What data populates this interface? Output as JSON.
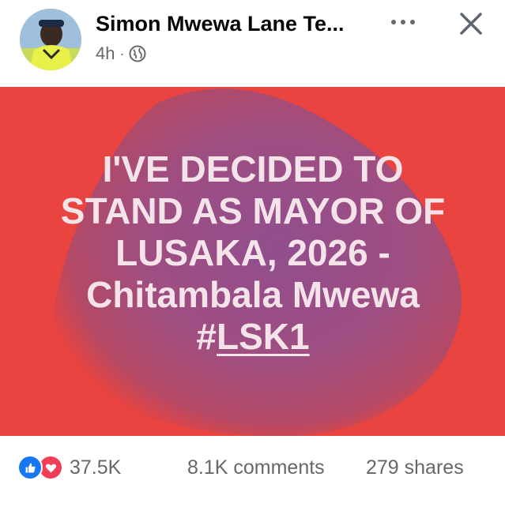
{
  "post": {
    "author": "Simon Mwewa Lane Te...",
    "time": "4h",
    "separator": "·",
    "privacy_icon": "globe-icon",
    "more_icon": "more-options-icon",
    "close_icon": "close-icon"
  },
  "image": {
    "lines": [
      "I'VE DECIDED TO",
      "STAND AS MAYOR OF",
      "LUSAKA, 2026 -",
      "Chitambala Mwewa"
    ],
    "hash": "#",
    "tag": "LSK1",
    "colors": {
      "background": "#e94440",
      "blob": "#9a4f8c",
      "text": "#f4e4ea"
    }
  },
  "stats": {
    "reaction_icons": [
      "like-icon",
      "love-icon"
    ],
    "reactions": "37.5K",
    "comments": "8.1K comments",
    "shares": "279 shares"
  }
}
